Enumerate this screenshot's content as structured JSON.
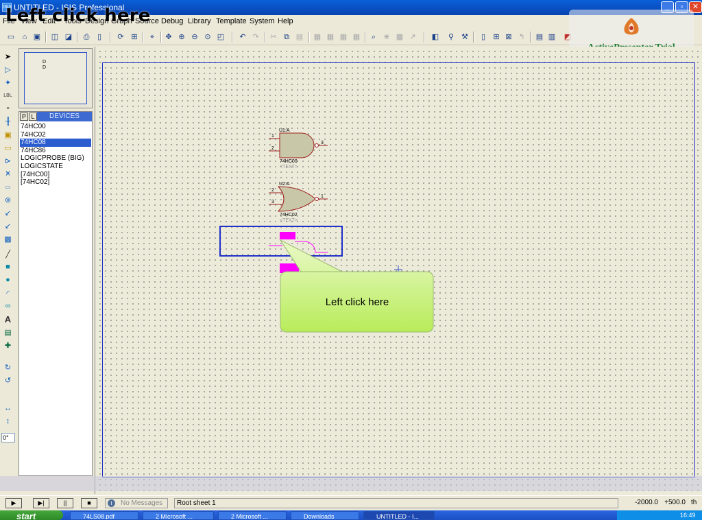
{
  "window": {
    "title": "UNTITLED - ISIS Professional",
    "app_icon_text": "ISIS",
    "minimize": "_",
    "maximize": "▫",
    "close": "✕"
  },
  "overlay_caption": "Left click here",
  "menu": [
    "File",
    "View",
    "Edit",
    "Tools",
    "Design",
    "Graph",
    "Source",
    "Debug",
    "Library",
    "Template",
    "System",
    "Help"
  ],
  "watermark": {
    "text": "ActivePresenter Trial",
    "color": "#1d7a2e"
  },
  "overview_label": "D",
  "device_panel": {
    "tab_p": "P",
    "tab_l": "L",
    "header": "DEVICES",
    "items": [
      {
        "label": "74HC00",
        "selected": false
      },
      {
        "label": "74HC02",
        "selected": false
      },
      {
        "label": "74HC08",
        "selected": true
      },
      {
        "label": "74HC86",
        "selected": false
      },
      {
        "label": "LOGICPROBE (BIG)",
        "selected": false
      },
      {
        "label": "LOGICSTATE",
        "selected": false
      },
      {
        "label": "[74HC00]",
        "selected": false
      },
      {
        "label": "[74HC02]",
        "selected": false
      }
    ]
  },
  "rotation_value": "0°",
  "schematic": {
    "gates": [
      {
        "ref": "U1:A",
        "part": "74HC00",
        "text": "<TEXT>",
        "pins": [
          "1",
          "2",
          "3"
        ]
      },
      {
        "ref": "U2:A",
        "part": "74HC02",
        "text": "<TEXT>",
        "pins": [
          "2",
          "3",
          "1"
        ]
      }
    ],
    "highlight_color": "#ff00ff",
    "selection_color": "#2030c8"
  },
  "callout": {
    "text": "Left click here"
  },
  "status": {
    "sim_buttons": [
      "▶",
      "▶|",
      "||",
      "■"
    ],
    "messages": "No Messages",
    "sheet": "Root sheet 1",
    "x": "-2000.0",
    "y": "+500.0",
    "unit": "th"
  },
  "taskbar": {
    "start": "start",
    "tasks": [
      "74LS08.pdf",
      "2 Microsoft ...",
      "2 Microsoft ...",
      "Downloads",
      "UNTITLED - I..."
    ],
    "tray_time": "16:49"
  },
  "colors": {
    "accent": "#0a5fd8",
    "selection": "#2c5dd0"
  }
}
